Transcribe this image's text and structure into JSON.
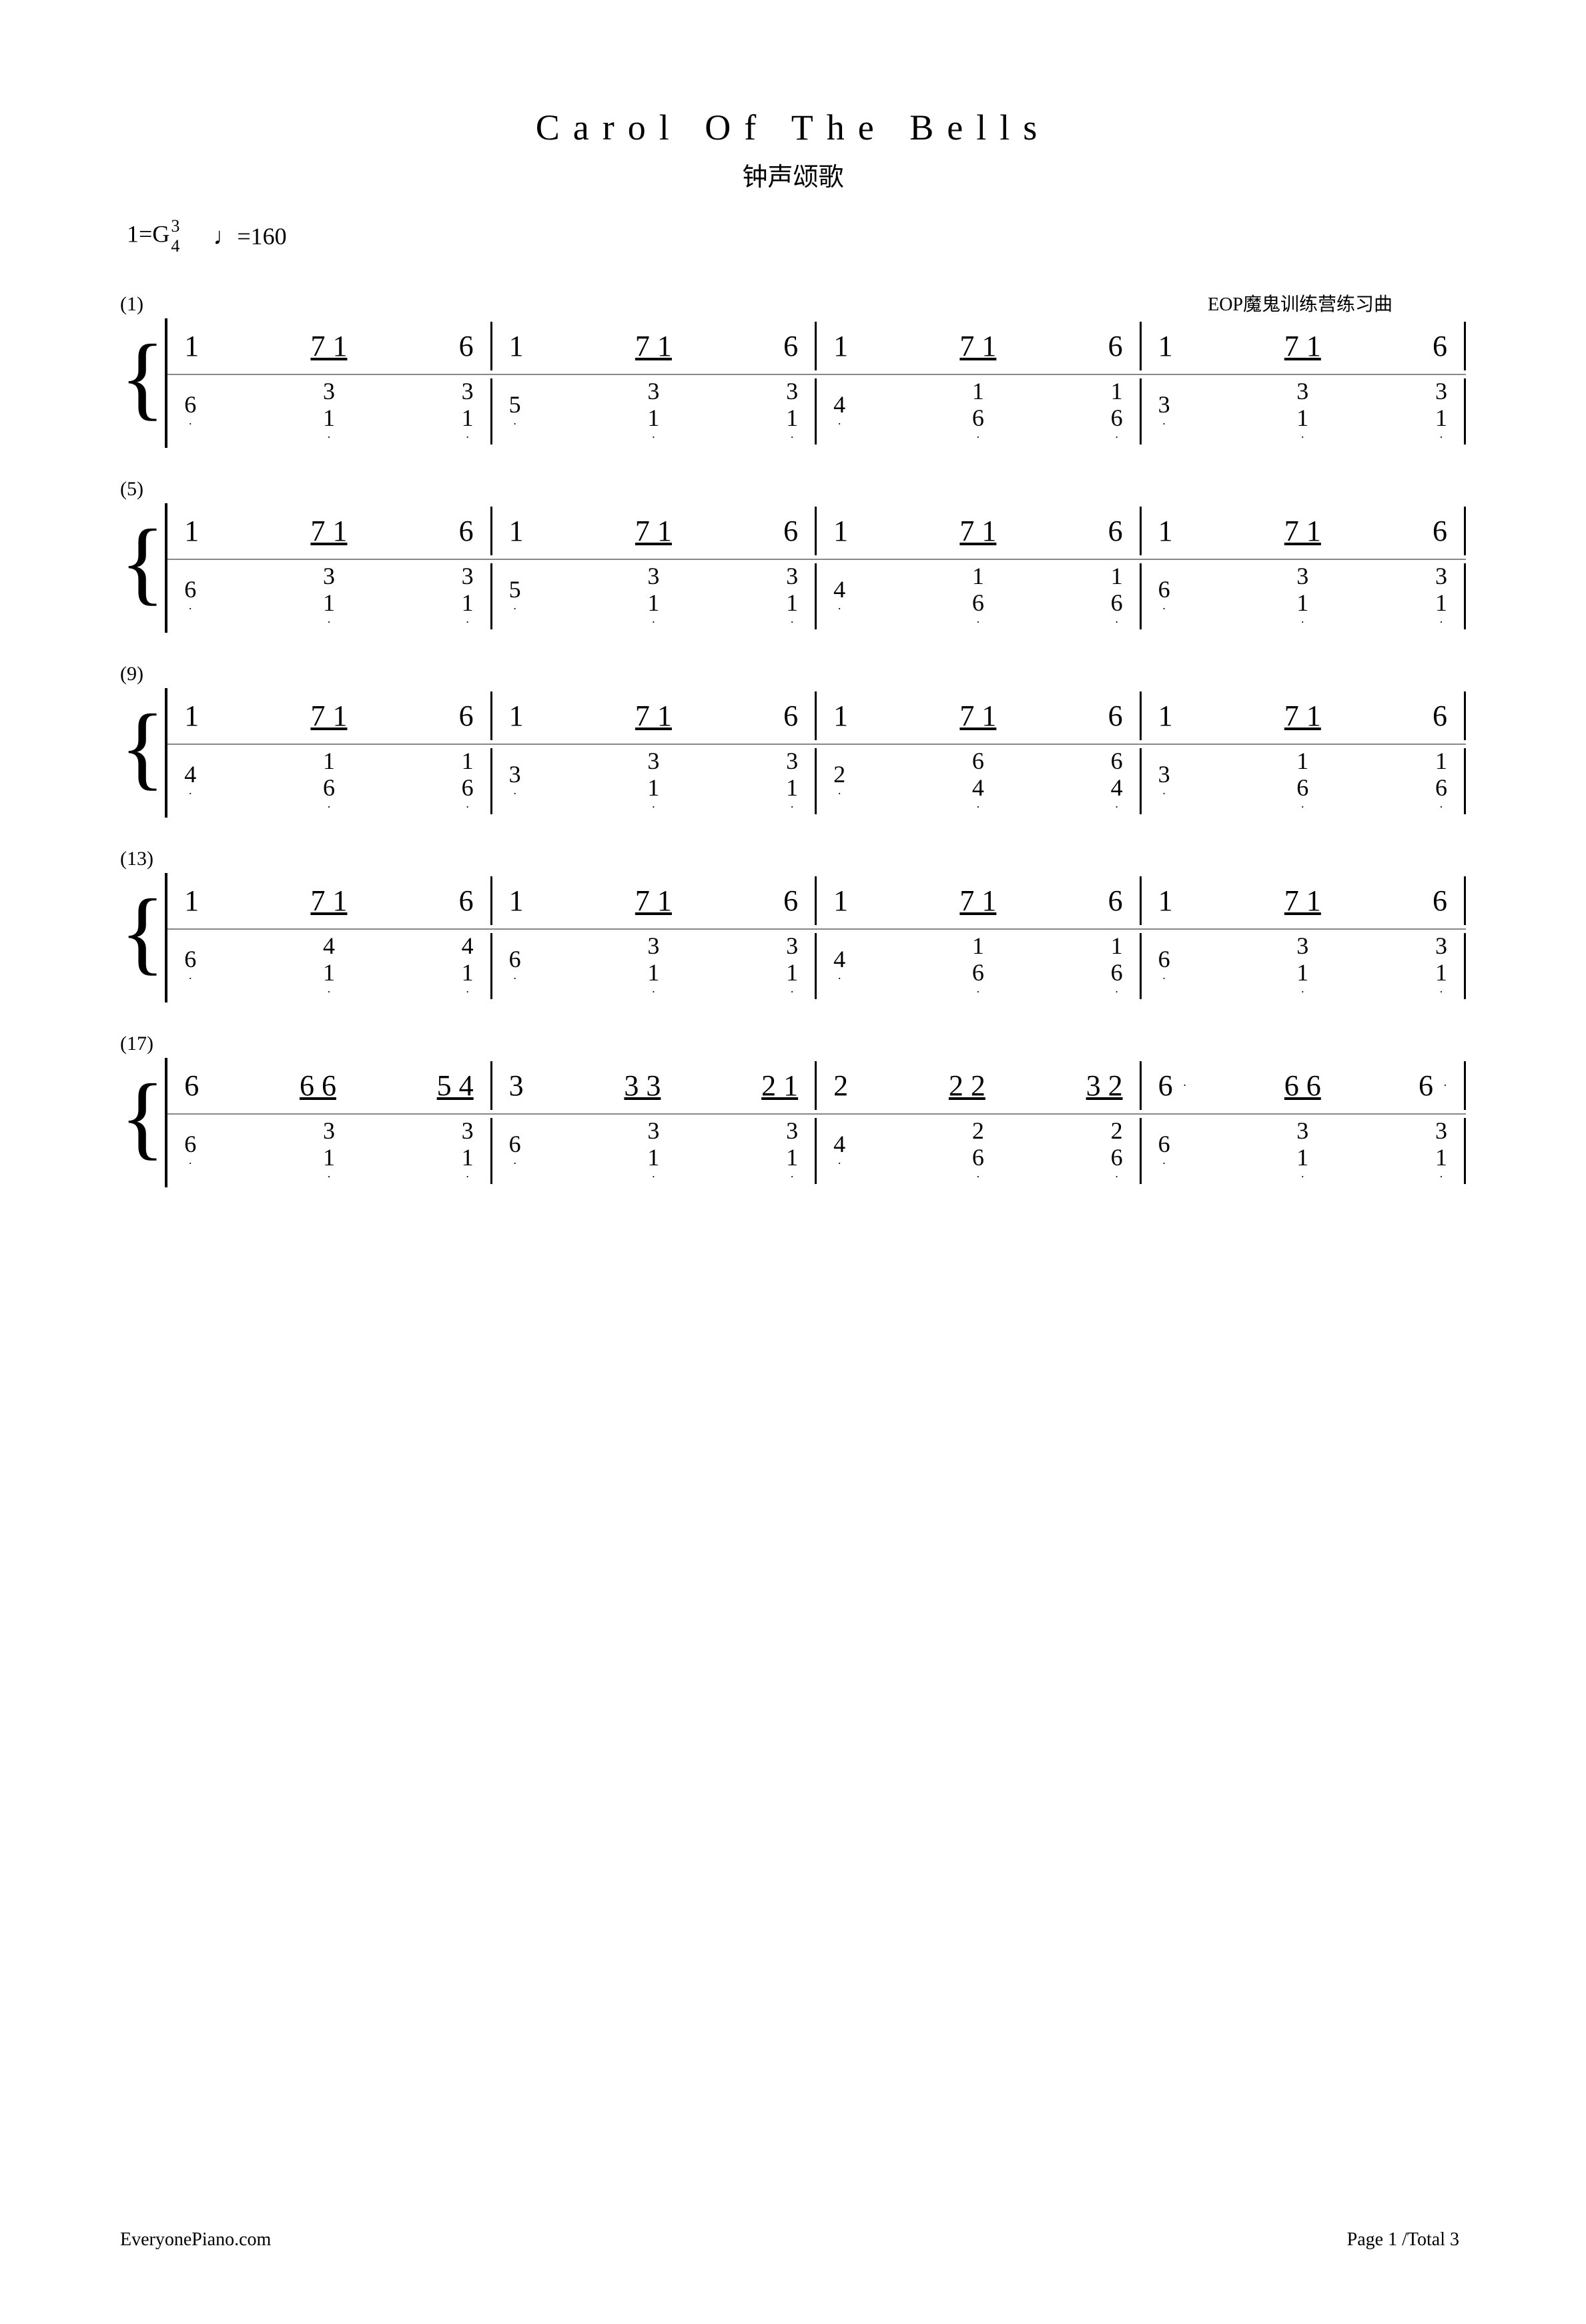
{
  "title": "Carol  Of  The  Bells",
  "subtitle": "钟声颂歌",
  "key": "1=G",
  "time": {
    "top": "3",
    "bottom": "4"
  },
  "tempo": "♩=160",
  "credit": "EOP魔鬼训练营练习曲",
  "footer": {
    "left": "EveryonePiano.com",
    "right": "Page 1 /Total 3"
  },
  "sections": [
    {
      "label": "(1)"
    },
    {
      "label": "(5)"
    },
    {
      "label": "(9)"
    },
    {
      "label": "(13)"
    },
    {
      "label": "(17)"
    }
  ]
}
